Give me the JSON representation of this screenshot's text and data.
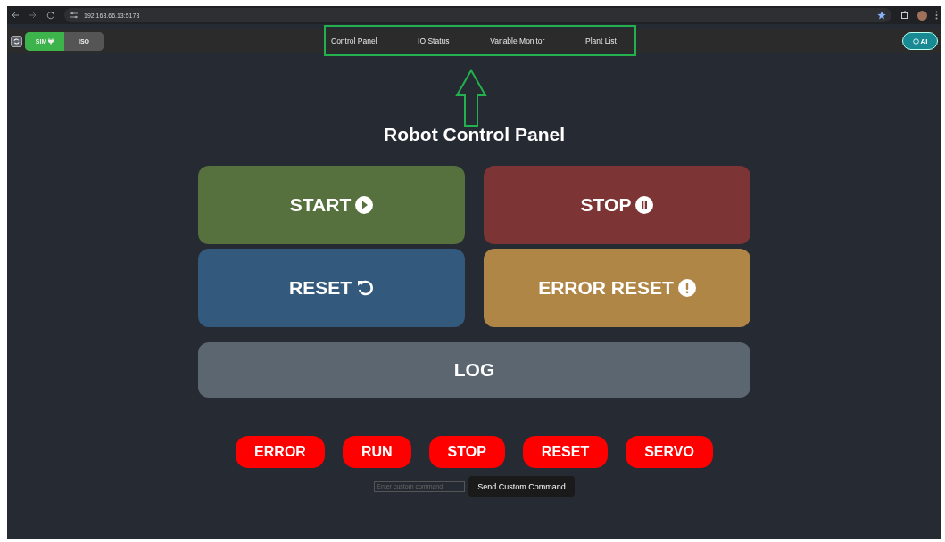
{
  "browser": {
    "url": "192.168.66.13:5173"
  },
  "mode_toggle": [
    {
      "label": "SIM",
      "selected": true
    },
    {
      "label": "ISO",
      "selected": false
    }
  ],
  "nav": [
    {
      "label": "Control Panel"
    },
    {
      "label": "IO Status"
    },
    {
      "label": "Variable Monitor"
    },
    {
      "label": "Plant List"
    }
  ],
  "ai_button": {
    "label": "AI"
  },
  "title": "Robot Control Panel",
  "controls": [
    {
      "label": "START",
      "kind": "play",
      "color": "#56703e"
    },
    {
      "label": "STOP",
      "kind": "pause",
      "color": "#7d3435"
    },
    {
      "label": "RESET",
      "kind": "undo",
      "color": "#33597d"
    },
    {
      "label": "ERROR RESET",
      "kind": "alert",
      "color": "#b08647"
    }
  ],
  "log_button": {
    "label": "LOG"
  },
  "commands": [
    {
      "label": "ERROR"
    },
    {
      "label": "RUN"
    },
    {
      "label": "STOP"
    },
    {
      "label": "RESET"
    },
    {
      "label": "SERVO"
    }
  ],
  "custom": {
    "placeholder": "Enter custom command",
    "button": "Send Custom Command"
  }
}
